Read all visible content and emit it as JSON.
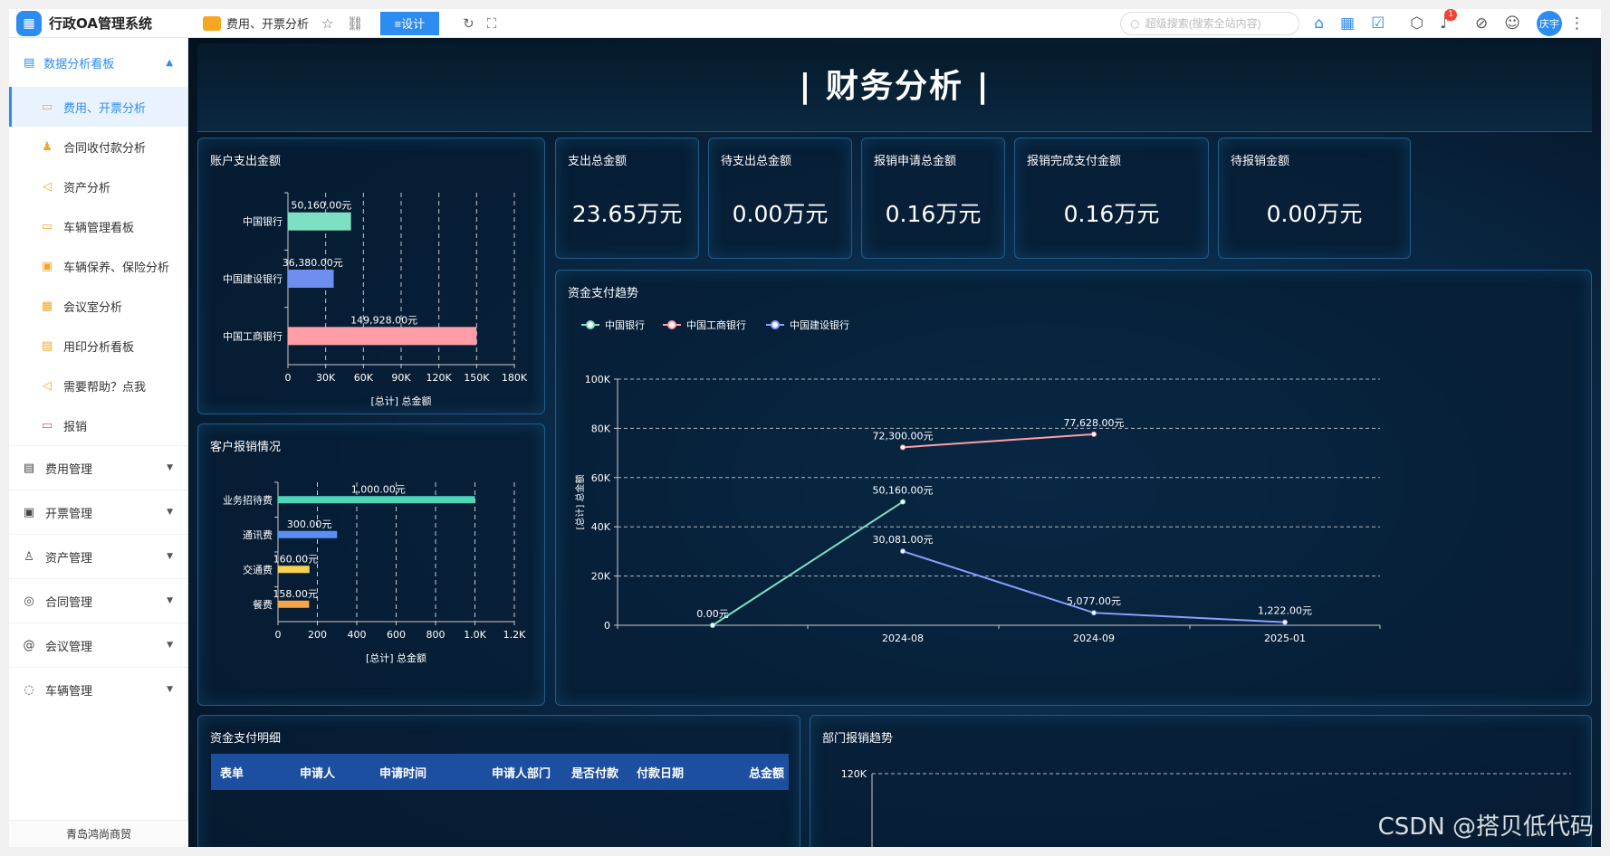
{
  "app": {
    "title": "行政OA管理系统",
    "logo_icon": "oa-logo-icon"
  },
  "topbar": {
    "page_title": "费用、开票分析",
    "design_button": "≡设计",
    "search_placeholder": "超级搜索(搜索全站内容)",
    "notification_count": "1",
    "user_avatar": "庆宇"
  },
  "sidebar": {
    "group_title": "数据分析看板",
    "items": [
      {
        "label": "费用、开票分析",
        "icon": "folder-icon",
        "active": true
      },
      {
        "label": "合同收付款分析",
        "icon": "users-icon"
      },
      {
        "label": "资产分析",
        "icon": "megaphone-icon"
      },
      {
        "label": "车辆管理看板",
        "icon": "car-icon"
      },
      {
        "label": "车辆保养、保险分析",
        "icon": "calendar-icon"
      },
      {
        "label": "会议室分析",
        "icon": "grid-icon"
      },
      {
        "label": "用印分析看板",
        "icon": "stamp-icon"
      },
      {
        "label": "需要帮助？点我",
        "icon": "megaphone-icon"
      },
      {
        "label": "报销",
        "icon": "receipt-icon"
      }
    ],
    "menus": [
      {
        "label": "费用管理",
        "icon": "document-icon"
      },
      {
        "label": "开票管理",
        "icon": "invoice-icon"
      },
      {
        "label": "资产管理",
        "icon": "person-icon"
      },
      {
        "label": "合同管理",
        "icon": "target-icon"
      },
      {
        "label": "会议管理",
        "icon": "at-icon"
      },
      {
        "label": "车辆管理",
        "icon": "chat-icon"
      }
    ],
    "footer": "青岛鸿尚商贸"
  },
  "dashboard": {
    "title": "| 财务分析 |",
    "kpis": [
      {
        "label": "支出总金额",
        "value": "23.65万元"
      },
      {
        "label": "待支出总金额",
        "value": "0.00万元"
      },
      {
        "label": "报销申请总金额",
        "value": "0.16万元"
      },
      {
        "label": "报销完成支付金额",
        "value": "0.16万元"
      },
      {
        "label": "待报销金额",
        "value": "0.00万元"
      }
    ],
    "panel_titles": {
      "account": "账户支出金额",
      "customer": "客户报销情况",
      "trend": "资金支付趋势",
      "detail": "资金支付明细",
      "dept": "部门报销趋势"
    },
    "table_headers": [
      "表单",
      "申请人",
      "申请时间",
      "申请人部门",
      "是否付款",
      "付款日期",
      "总金额"
    ],
    "watermark": "CSDN @搭贝低代码"
  },
  "chart_data": [
    {
      "type": "bar",
      "orientation": "horizontal",
      "title": "账户支出金额",
      "categories": [
        "中国银行",
        "中国建设银行",
        "中国工商银行"
      ],
      "values": [
        50160,
        36380,
        149928
      ],
      "data_labels": [
        "50,160.00元",
        "36,380.00元",
        "149,928.00元"
      ],
      "colors": [
        "#7ee0c3",
        "#6f8ff0",
        "#ff9ea6"
      ],
      "xlabel": "[总计] 总金额",
      "ticks": [
        "0",
        "30K",
        "60K",
        "90K",
        "120K",
        "150K",
        "180K"
      ],
      "xlim": [
        0,
        180000
      ]
    },
    {
      "type": "bar",
      "orientation": "horizontal",
      "title": "客户报销情况",
      "categories": [
        "业务招待费",
        "通讯费",
        "交通费",
        "餐费"
      ],
      "values": [
        1000,
        300,
        160,
        158
      ],
      "data_labels": [
        "1,000.00元",
        "300.00元",
        "160.00元",
        "158.00元"
      ],
      "colors": [
        "#4fd6b6",
        "#5b8ef5",
        "#f5d24d",
        "#f5a64a"
      ],
      "xlabel": "[总计] 总金额",
      "ticks": [
        "0",
        "200",
        "400",
        "600",
        "800",
        "1.0K",
        "1.2K"
      ],
      "xlim": [
        0,
        1200
      ]
    },
    {
      "type": "line",
      "title": "资金支付趋势",
      "x": [
        "2024-08",
        "2024-09",
        "2025-01"
      ],
      "ylabel": "[总计] 总金额",
      "y_ticks": [
        "0",
        "20K",
        "40K",
        "60K",
        "80K",
        "100K"
      ],
      "ylim": [
        0,
        100000
      ],
      "series": [
        {
          "name": "中国银行",
          "color": "#7ee0c3",
          "points": [
            {
              "x": "2024-07",
              "y": 0,
              "label": "0.00元"
            },
            {
              "x": "2024-08",
              "y": 50160,
              "label": "50,160.00元"
            }
          ]
        },
        {
          "name": "中国工商银行",
          "color": "#ff9ea6",
          "points": [
            {
              "x": "2024-08",
              "y": 72300,
              "label": "72,300.00元"
            },
            {
              "x": "2024-09",
              "y": 77628,
              "label": "77,628.00元"
            }
          ]
        },
        {
          "name": "中国建设银行",
          "color": "#8aa0ff",
          "points": [
            {
              "x": "2024-08",
              "y": 30081,
              "label": "30,081.00元"
            },
            {
              "x": "2024-09",
              "y": 5077,
              "label": "5,077.00元"
            },
            {
              "x": "2025-01",
              "y": 1222,
              "label": "1,222.00元"
            }
          ]
        }
      ]
    },
    {
      "type": "line",
      "title": "部门报销趋势",
      "y_ticks": [
        "120K"
      ]
    }
  ]
}
